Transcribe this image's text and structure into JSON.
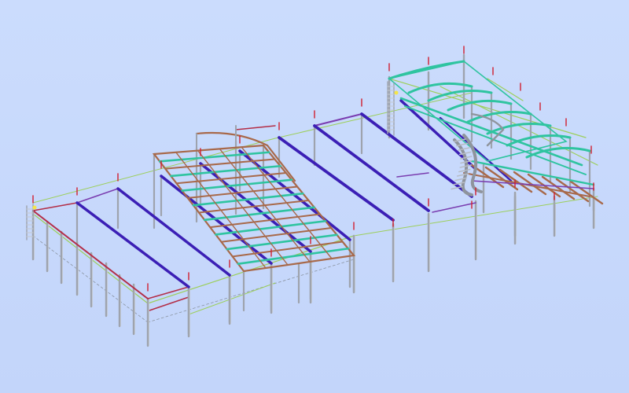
{
  "viewport": {
    "background": "#c7d8fb",
    "view": "isometric",
    "render_mode": "wireframe"
  },
  "model": {
    "type": "steel-frame-building",
    "blocks": [
      "left-hall",
      "center-mezzanine",
      "right-hall-with-stair"
    ],
    "left_hall_bays": 6,
    "colors": {
      "column": "#9ea3ad",
      "column_light": "#c4c8cf",
      "rafter": "#3b1fb5",
      "rafter_alt": "#7d2fa8",
      "eave_beam": "#b32e47",
      "eave_beam_alt": "#7a3db0",
      "purlin": "#2fc4a0",
      "secondary_beam": "#a8694a",
      "bracing": "#9ccf5a",
      "bracing_dashed": "#8a93a0",
      "stair": "#8f949c",
      "anchor_tick": "#d11f2f",
      "marker": "#f4e44a"
    },
    "icons": [
      "ladder-icon",
      "ladder-icon"
    ]
  }
}
